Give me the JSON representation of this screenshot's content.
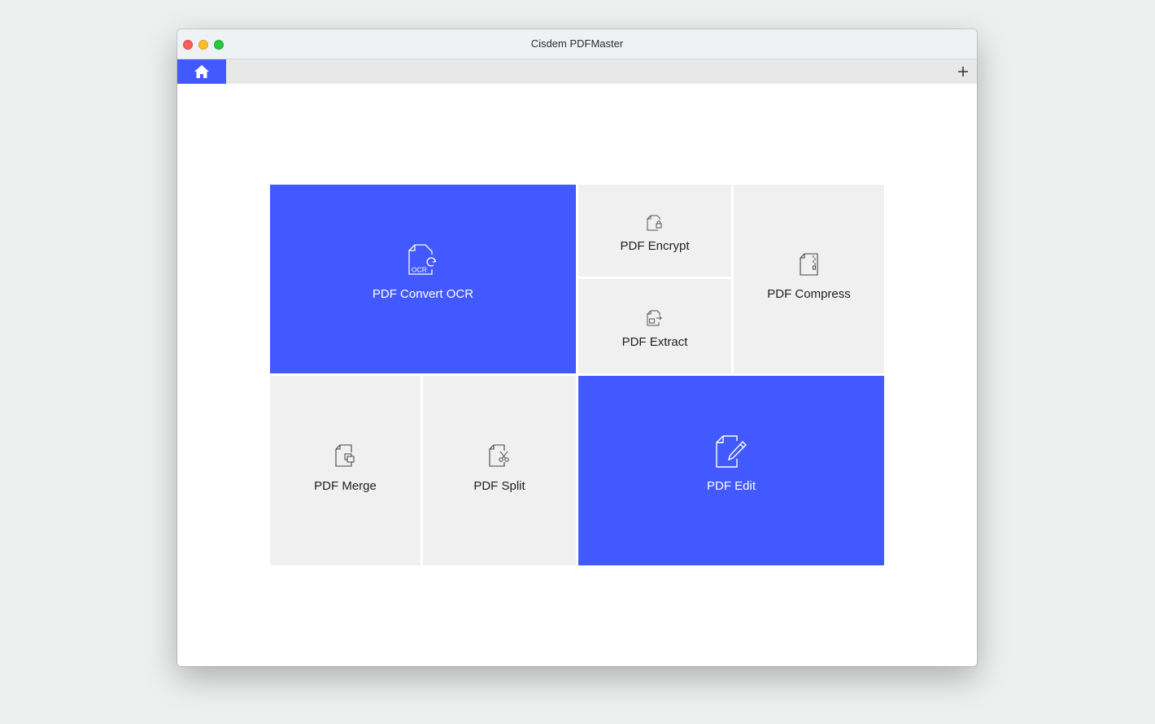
{
  "window": {
    "title": "Cisdem PDFMaster"
  },
  "tabs": {
    "home_icon": "home-icon",
    "add_icon": "plus-icon"
  },
  "tiles": {
    "convert_ocr": {
      "label": "PDF Convert OCR",
      "icon": "ocr-document-icon",
      "icon_text": "OCR"
    },
    "encrypt": {
      "label": "PDF Encrypt",
      "icon": "lock-document-icon"
    },
    "extract": {
      "label": "PDF Extract",
      "icon": "extract-document-icon"
    },
    "compress": {
      "label": "PDF Compress",
      "icon": "zip-document-icon"
    },
    "merge": {
      "label": "PDF Merge",
      "icon": "merge-document-icon"
    },
    "split": {
      "label": "PDF Split",
      "icon": "scissors-document-icon"
    },
    "edit": {
      "label": "PDF Edit",
      "icon": "pencil-document-icon"
    }
  },
  "colors": {
    "accent": "#4259ff",
    "tile_gray": "#f0f0f0"
  }
}
